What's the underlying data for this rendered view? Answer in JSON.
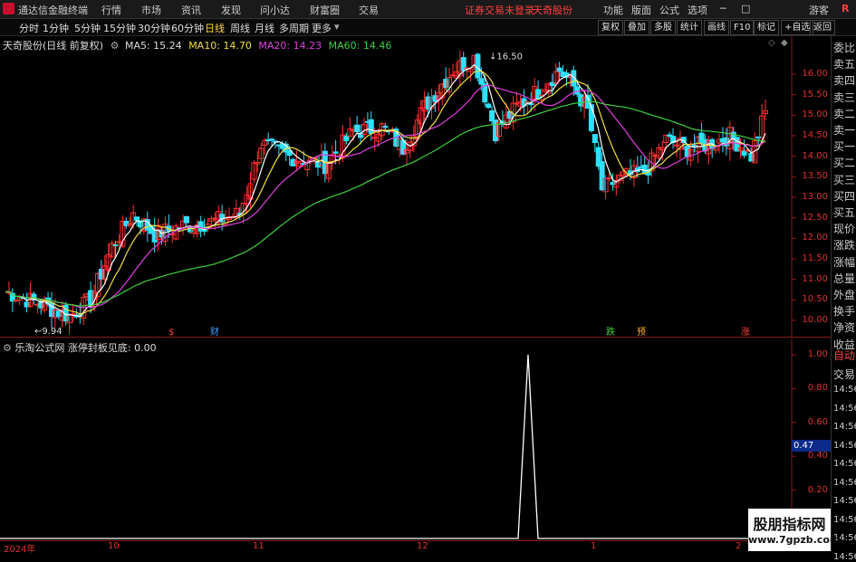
{
  "titlebar": {
    "app_name": "通达信金融终端",
    "menu": [
      "行情",
      "市场",
      "资讯",
      "发现",
      "问小达",
      "财富圈",
      "交易"
    ],
    "notice": "证券交易未登录",
    "stock": "天奇股份",
    "right_menu": [
      "功能",
      "版面",
      "公式",
      "选项"
    ],
    "guest": "游客",
    "r_label": "R"
  },
  "toolbar": {
    "periods": [
      "分时",
      "1分钟",
      "5分钟",
      "15分钟",
      "30分钟",
      "60分钟",
      "日线",
      "周线",
      "月线",
      "多周期",
      "更多"
    ],
    "active_period": "日线",
    "buttons": [
      "复权",
      "叠加",
      "多股",
      "统计",
      "画线",
      "F10",
      "标记",
      "+自选",
      "返回"
    ]
  },
  "main_chart": {
    "header_title": "天奇股份(日线 前复权)",
    "ma_items": [
      {
        "label": "MA5: 15.24",
        "color": "#ffffff"
      },
      {
        "label": "MA10: 14.70",
        "color": "#f0e040"
      },
      {
        "label": "MA20: 14.23",
        "color": "#e040e0"
      },
      {
        "label": "MA60: 14.46",
        "color": "#40d040"
      }
    ],
    "y_labels": [
      "16.00",
      "15.50",
      "15.00",
      "14.50",
      "14.00",
      "13.50",
      "13.00",
      "12.50",
      "12.00",
      "11.50",
      "11.00",
      "10.50",
      "10.00"
    ],
    "high_marker": "16.50",
    "low_marker": "9.94",
    "event_markers": [
      "$",
      "财",
      "跌",
      "预",
      "涨"
    ]
  },
  "sub_chart": {
    "header_title": "乐淘公式网 涨停封板见底: 0.00",
    "y_labels": [
      "1.00",
      "0.80",
      "0.60",
      "0.40",
      "0.20"
    ],
    "cursor_value": "0.47"
  },
  "x_axis": {
    "labels": [
      "2024年",
      "10",
      "11",
      "12",
      "1",
      "2"
    ]
  },
  "sidebar": {
    "items": [
      "委比",
      "卖五",
      "卖四",
      "卖三",
      "卖二",
      "卖一",
      "买一",
      "买二",
      "买三",
      "买四",
      "买五",
      "现价",
      "涨跌",
      "涨幅",
      "总量",
      "外盘",
      "换手",
      "净资",
      "收益"
    ],
    "trade_items": [
      "自动",
      "交易",
      "14:56",
      "14:56",
      "14:56",
      "14:56",
      "14:56",
      "14:56",
      "14:56",
      "14:56",
      "14:56",
      "14:56"
    ]
  },
  "watermark": {
    "line1": "股朋指标网",
    "line2": "www.7gpzb.com"
  },
  "colors": {
    "up": "#ff3030",
    "down": "#30e0ff",
    "ma5": "#ffffff",
    "ma10": "#f0e040",
    "ma20": "#e040e0",
    "ma60": "#40d040",
    "axis": "#e03030"
  }
}
